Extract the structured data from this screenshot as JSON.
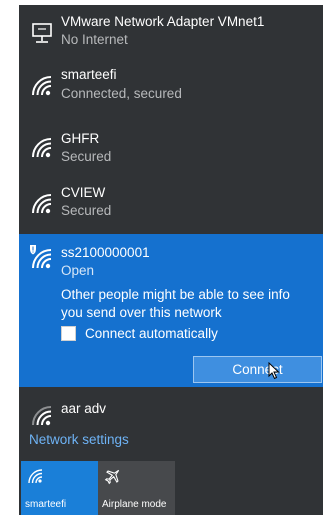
{
  "networks": {
    "vmnet": {
      "name": "VMware Network Adapter VMnet1",
      "status": "No Internet",
      "icon": "ethernet-computer-icon"
    },
    "smarteefi": {
      "name": "smarteefi",
      "status": "Connected, secured",
      "icon": "wifi-icon"
    },
    "ghfr": {
      "name": "GHFR",
      "status": "Secured",
      "icon": "wifi-icon"
    },
    "cview": {
      "name": "CVIEW",
      "status": "Secured",
      "icon": "wifi-icon"
    },
    "selected": {
      "name": "ss2100000001",
      "status": "Open",
      "icon": "wifi-shield-warning-icon",
      "warning": "Other people might be able to see info you send over this network",
      "auto_connect_label": "Connect automatically",
      "auto_connect_checked": false,
      "connect_label": "Connect"
    },
    "aar": {
      "name": "aar adv",
      "icon": "wifi-icon"
    }
  },
  "network_settings_label": "Network settings",
  "quick_actions": [
    {
      "label": "smarteefi",
      "icon": "wifi-icon",
      "active": true
    },
    {
      "label": "Airplane mode",
      "icon": "airplane-icon",
      "active": false
    }
  ],
  "colors": {
    "flyout_bg": "#303336",
    "selected_bg": "#1571cf",
    "accent_link": "#6eb3f5",
    "active_tile": "#1a7fd8",
    "inactive_tile": "#47494c"
  }
}
